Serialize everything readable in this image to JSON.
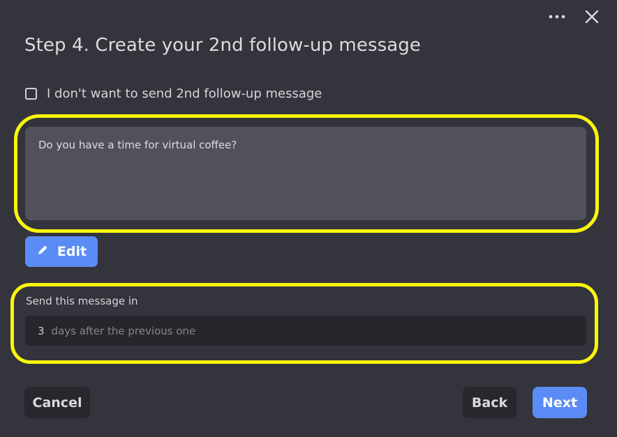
{
  "dialog": {
    "title": "Step 4. Create your 2nd follow-up message",
    "menu_icon": "more-horizontal-icon",
    "close_icon": "close-icon"
  },
  "opt_out": {
    "label": "I don't want to send 2nd follow-up message",
    "checked": false
  },
  "message": {
    "text": "Do you have a time for virtual coffee?"
  },
  "edit": {
    "label": "Edit",
    "icon": "pencil-icon"
  },
  "delay": {
    "label": "Send this message in",
    "value": "3",
    "suffix": "days after the previous one"
  },
  "footer": {
    "cancel_label": "Cancel",
    "back_label": "Back",
    "next_label": "Next"
  },
  "colors": {
    "background": "#33343c",
    "accent": "#5b8cf5",
    "highlight": "#fbf60a",
    "field": "#50515a",
    "input": "#26272d"
  }
}
